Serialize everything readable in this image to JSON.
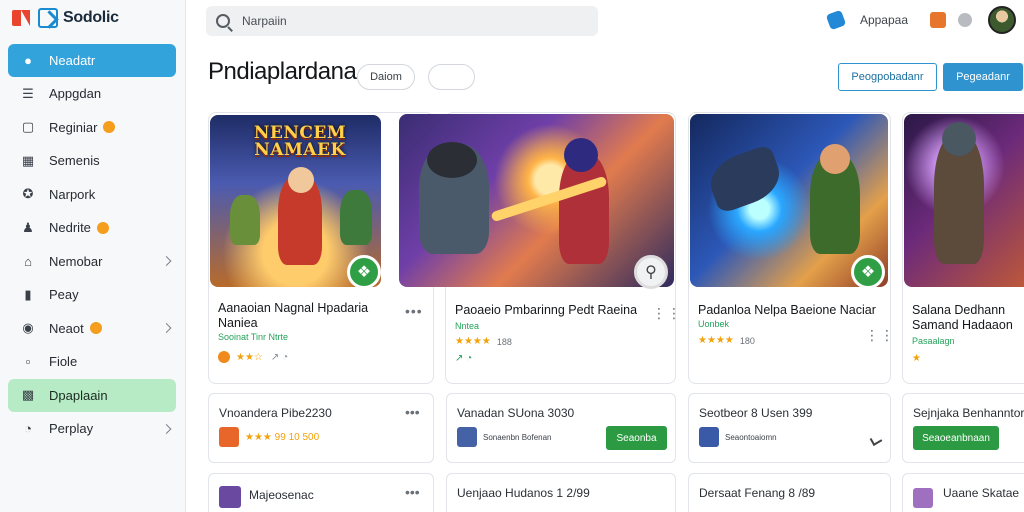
{
  "app": {
    "name": "Sodolic"
  },
  "sidebar": {
    "items": [
      {
        "label": "Neadatr",
        "icon": "user-icon",
        "active": true
      },
      {
        "label": "Appgdan",
        "icon": "list-icon"
      },
      {
        "label": "Reginiar",
        "icon": "chat-icon",
        "badge": true
      },
      {
        "label": "Semenis",
        "icon": "grid-icon"
      },
      {
        "label": "Narpork",
        "icon": "pin-icon"
      },
      {
        "label": "Nedrite",
        "icon": "person-icon",
        "badge": true
      },
      {
        "label": "Nemobar",
        "icon": "home-icon",
        "chevron": true
      },
      {
        "label": "Peay",
        "icon": "doc-icon"
      },
      {
        "label": "Neaot",
        "icon": "gamepad-icon",
        "badge": true,
        "chevron": true
      },
      {
        "label": "Fiole",
        "icon": "folder-icon"
      },
      {
        "label": "Dpaplaain",
        "icon": "box-icon",
        "highlight": true
      },
      {
        "label": "Perplay",
        "icon": "clock-icon",
        "chevron": true
      }
    ]
  },
  "search": {
    "placeholder": "Narpaiin"
  },
  "topbar": {
    "label": "Appapaa"
  },
  "header": {
    "title": "Pndiaplardana",
    "chip1": "Daiom",
    "chip2": "",
    "btn_outline": "Peogpobadanr",
    "btn_solid": "Pegeadanr"
  },
  "cards": [
    {
      "art_title": "NENCEM NAMAEK",
      "title": "Aanaoian Nagnal Hpadaria Naniea",
      "sub": "Sooinat Tinr Ntrte",
      "rating": "★★☆",
      "num": "",
      "extra": "↗ ◔"
    },
    {
      "title": "Paoaeio Pmbarinng Pedt Raeina",
      "sub": "Nntea",
      "rating": "★★★★",
      "num": "188",
      "extra": "↗ ◔"
    },
    {
      "title": "Padanloa Nelpa Baeione Naciar",
      "sub": "Uonbek",
      "rating": "★★★★",
      "num": "180",
      "extra": ""
    },
    {
      "title": "Salana Dedhann Samand Hadaaon",
      "sub": "Pasaalagn",
      "rating": "★",
      "num": "",
      "extra": ""
    }
  ],
  "rows": [
    {
      "title": "Vnoandera Pibe2230",
      "meta": "★★★  99 10 500",
      "button": ""
    },
    {
      "title": "Vanadan SUona 3030",
      "meta": "Sonaenbn Bofenan",
      "button": "Seaonba"
    },
    {
      "title": "Seotbeor 8 Usen 399",
      "meta": "Seaontoaiomn",
      "button": ""
    },
    {
      "title": "Sejnjaka Benhanntor",
      "meta": "",
      "button": "Seaoeanbnaan"
    }
  ],
  "rows_bottom": [
    {
      "title": "Majeosenac"
    },
    {
      "title": "Uenjaao Hudanos 1 2/99"
    },
    {
      "title": "Dersaat Fenang 8 /89"
    },
    {
      "title": "Uaane Skatae"
    }
  ]
}
